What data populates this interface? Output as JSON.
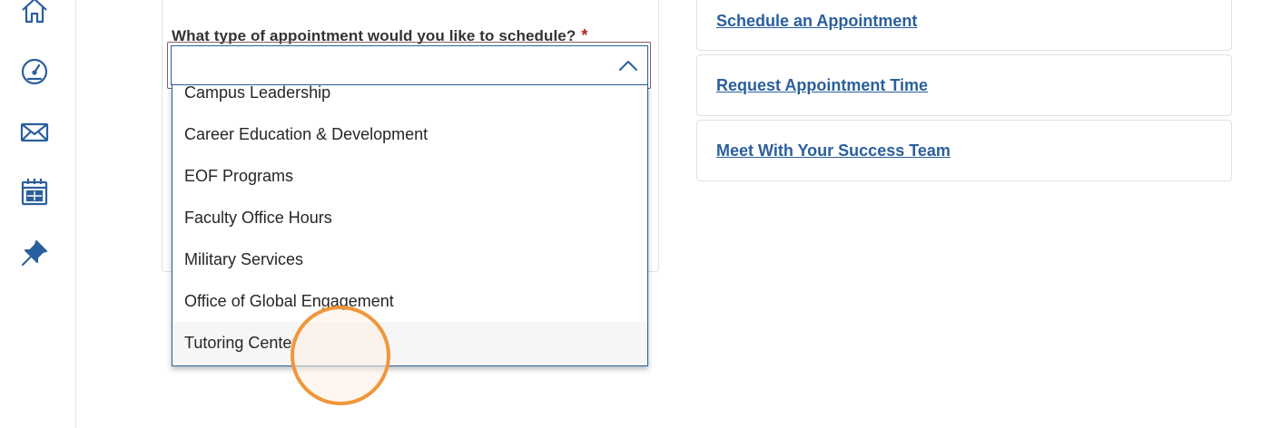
{
  "colors": {
    "accent": "#2a5f9e",
    "required": "#b3261e",
    "click_marker": "#f0963c"
  },
  "sidebar": {
    "icons": [
      "home-icon",
      "dashboard-gauge-icon",
      "mail-icon",
      "calendar-icon",
      "pin-icon"
    ]
  },
  "form": {
    "question": "What type of appointment would you like to schedule?",
    "required_marker": "*",
    "select_value": "",
    "options": [
      "Campus Leadership",
      "Career Education & Development",
      "EOF Programs",
      "Faculty Office Hours",
      "Military Services",
      "Office of Global Engagement",
      "Tutoring Center"
    ],
    "hovered_option": "Tutoring Center"
  },
  "links": {
    "schedule": "Schedule an Appointment",
    "request": "Request Appointment Time",
    "meet": "Meet With Your Success Team"
  }
}
